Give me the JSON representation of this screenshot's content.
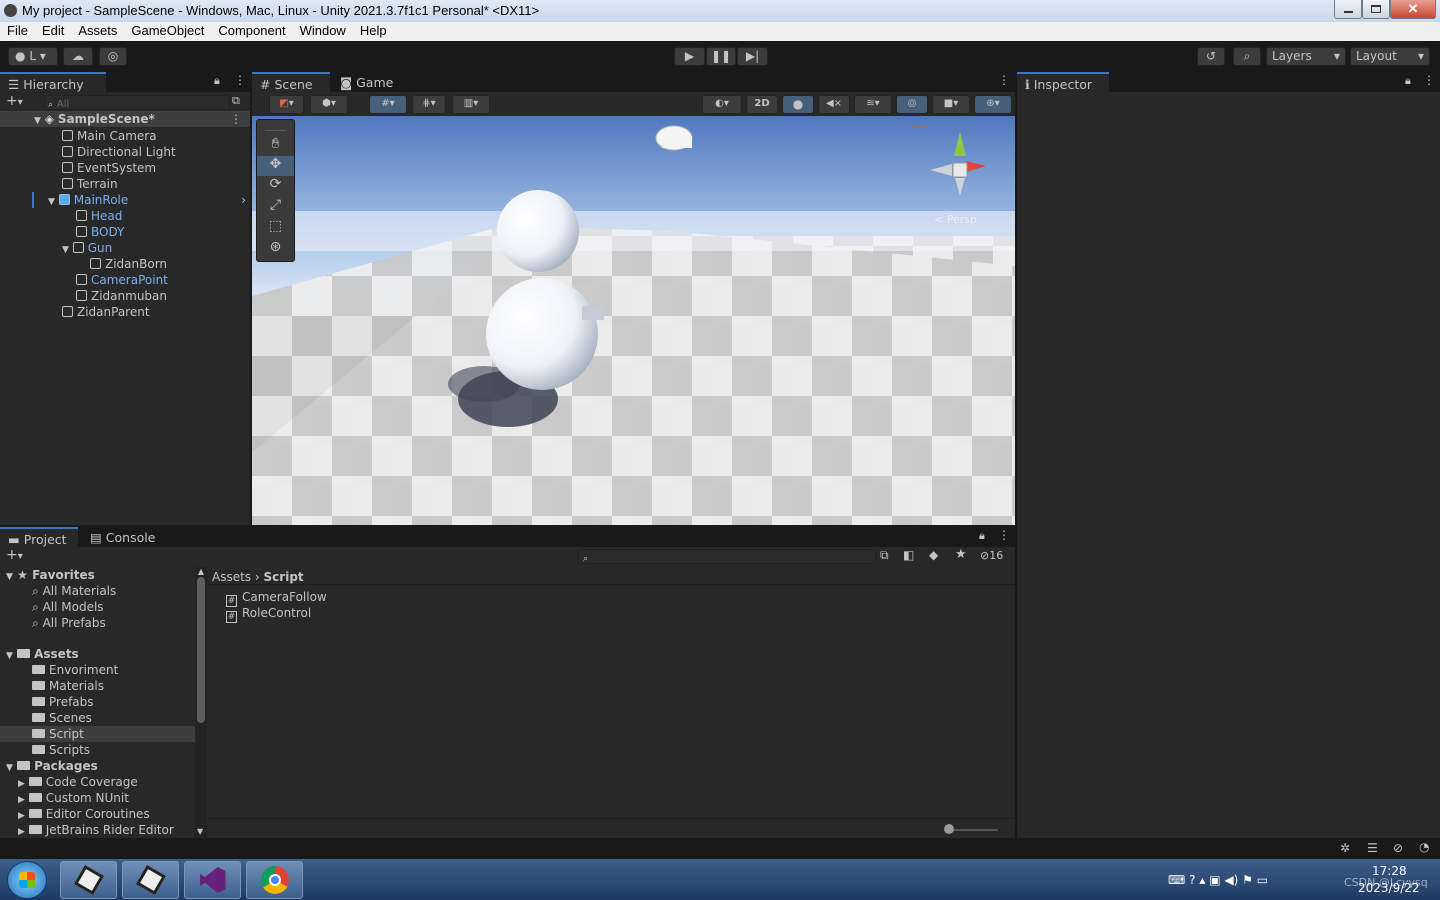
{
  "window": {
    "title": "My project - SampleScene - Windows, Mac, Linux - Unity 2021.3.7f1c1 Personal* <DX11>"
  },
  "menu": [
    "File",
    "Edit",
    "Assets",
    "GameObject",
    "Component",
    "Window",
    "Help"
  ],
  "toolbar": {
    "account_label": "L",
    "layers_label": "Layers",
    "layout_label": "Layout"
  },
  "hierarchy": {
    "tab": "Hierarchy",
    "search_placeholder": "All",
    "scene": "SampleScene*",
    "items": [
      {
        "label": "Main Camera",
        "depth": 1,
        "blue": false
      },
      {
        "label": "Directional Light",
        "depth": 1,
        "blue": false
      },
      {
        "label": "EventSystem",
        "depth": 1,
        "blue": false
      },
      {
        "label": "Terrain",
        "depth": 1,
        "blue": false
      },
      {
        "label": "MainRole",
        "depth": 1,
        "blue": true
      },
      {
        "label": "Head",
        "depth": 2,
        "blue": true
      },
      {
        "label": "BODY",
        "depth": 2,
        "blue": true
      },
      {
        "label": "Gun",
        "depth": 2,
        "blue": true
      },
      {
        "label": "ZidanBorn",
        "depth": 3,
        "blue": false
      },
      {
        "label": "CameraPoint",
        "depth": 2,
        "blue": true
      },
      {
        "label": "Zidanmuban",
        "depth": 2,
        "blue": false
      },
      {
        "label": "ZidanParent",
        "depth": 1,
        "blue": false
      }
    ]
  },
  "scene_tabs": {
    "scene": "Scene",
    "game": "Game",
    "btn_2d": "2D",
    "persp": "< Persp"
  },
  "inspector": {
    "tab": "Inspector"
  },
  "project": {
    "tab_project": "Project",
    "tab_console": "Console",
    "hidden_count": "16",
    "favorites_label": "Favorites",
    "favorites": [
      "All Materials",
      "All Models",
      "All Prefabs"
    ],
    "assets_label": "Assets",
    "assets": [
      "Envoriment",
      "Materials",
      "Prefabs",
      "Scenes",
      "Script",
      "Scripts"
    ],
    "packages_label": "Packages",
    "packages": [
      "Code Coverage",
      "Custom NUnit",
      "Editor Coroutines",
      "JetBrains Rider Editor"
    ],
    "breadcrumb_root": "Assets",
    "breadcrumb_current": "Script",
    "files": [
      "CameraFollow",
      "RoleControl"
    ]
  },
  "taskbar": {
    "time": "17:28",
    "date": "2023/9/22",
    "watermark": "CSDN @Lcyysq"
  }
}
